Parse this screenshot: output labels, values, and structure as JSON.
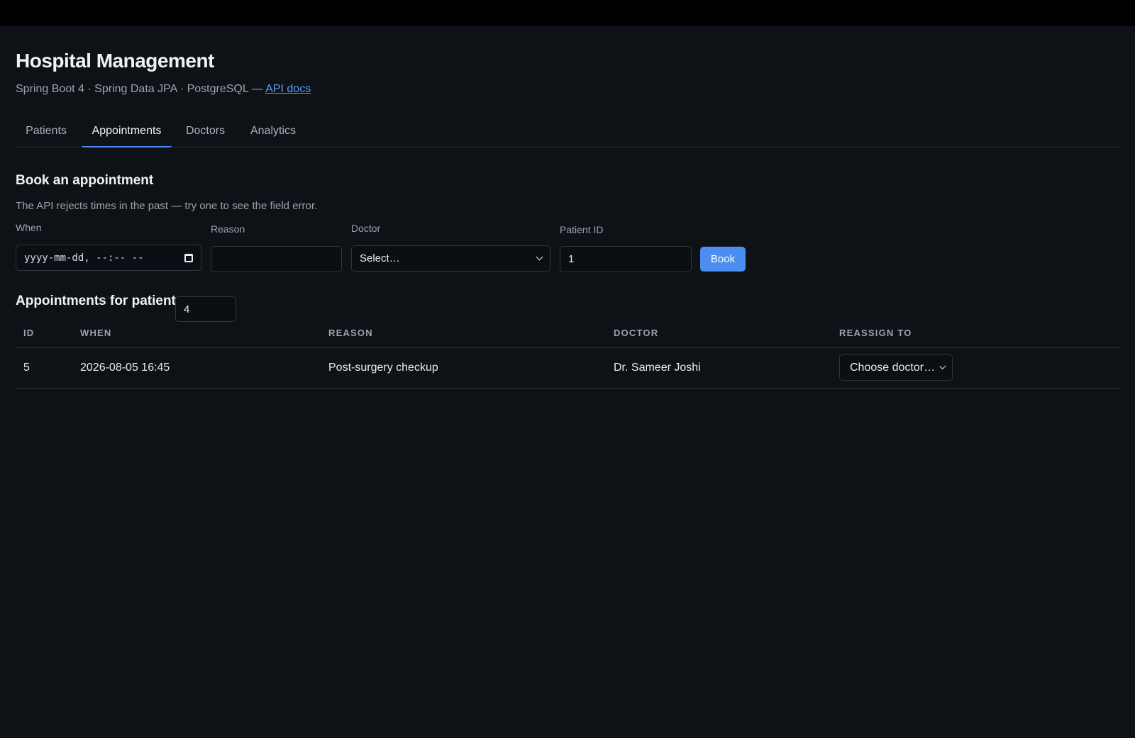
{
  "app": {
    "title": "Hospital Management",
    "subtitle": "Spring Boot 4 · Spring Data JPA · PostgreSQL — ",
    "api_link": "API docs"
  },
  "tabs": [
    {
      "label": "Patients",
      "active": false
    },
    {
      "label": "Appointments",
      "active": true
    },
    {
      "label": "Doctors",
      "active": false
    },
    {
      "label": "Analytics",
      "active": false
    }
  ],
  "booking": {
    "title": "Book an appointment",
    "note": "The API rejects times in the past — try one to see the field error.",
    "when_label": "When",
    "when_placeholder": "yyyy-mm-dd, --:-- --",
    "reason_label": "Reason",
    "reason_value": "",
    "doctor_label": "Doctor",
    "doctor_selected": "Select…",
    "patient_label": "Patient ID",
    "patient_value": "1",
    "book_label": "Book"
  },
  "appointments": {
    "title": "Appointments for patient",
    "patient_value": "4",
    "columns": [
      "ID",
      "WHEN",
      "REASON",
      "DOCTOR",
      "REASSIGN TO"
    ],
    "rows": [
      {
        "id": "5",
        "when": "2026-08-05 16:45",
        "reason": "Post-surgery checkup",
        "doctor": "Dr. Sameer Joshi",
        "reassign": "Choose doctor…"
      }
    ]
  },
  "colors": {
    "background": "#0e1217",
    "accent": "#4c8ef0",
    "muted_text": "#9aa4ae"
  }
}
